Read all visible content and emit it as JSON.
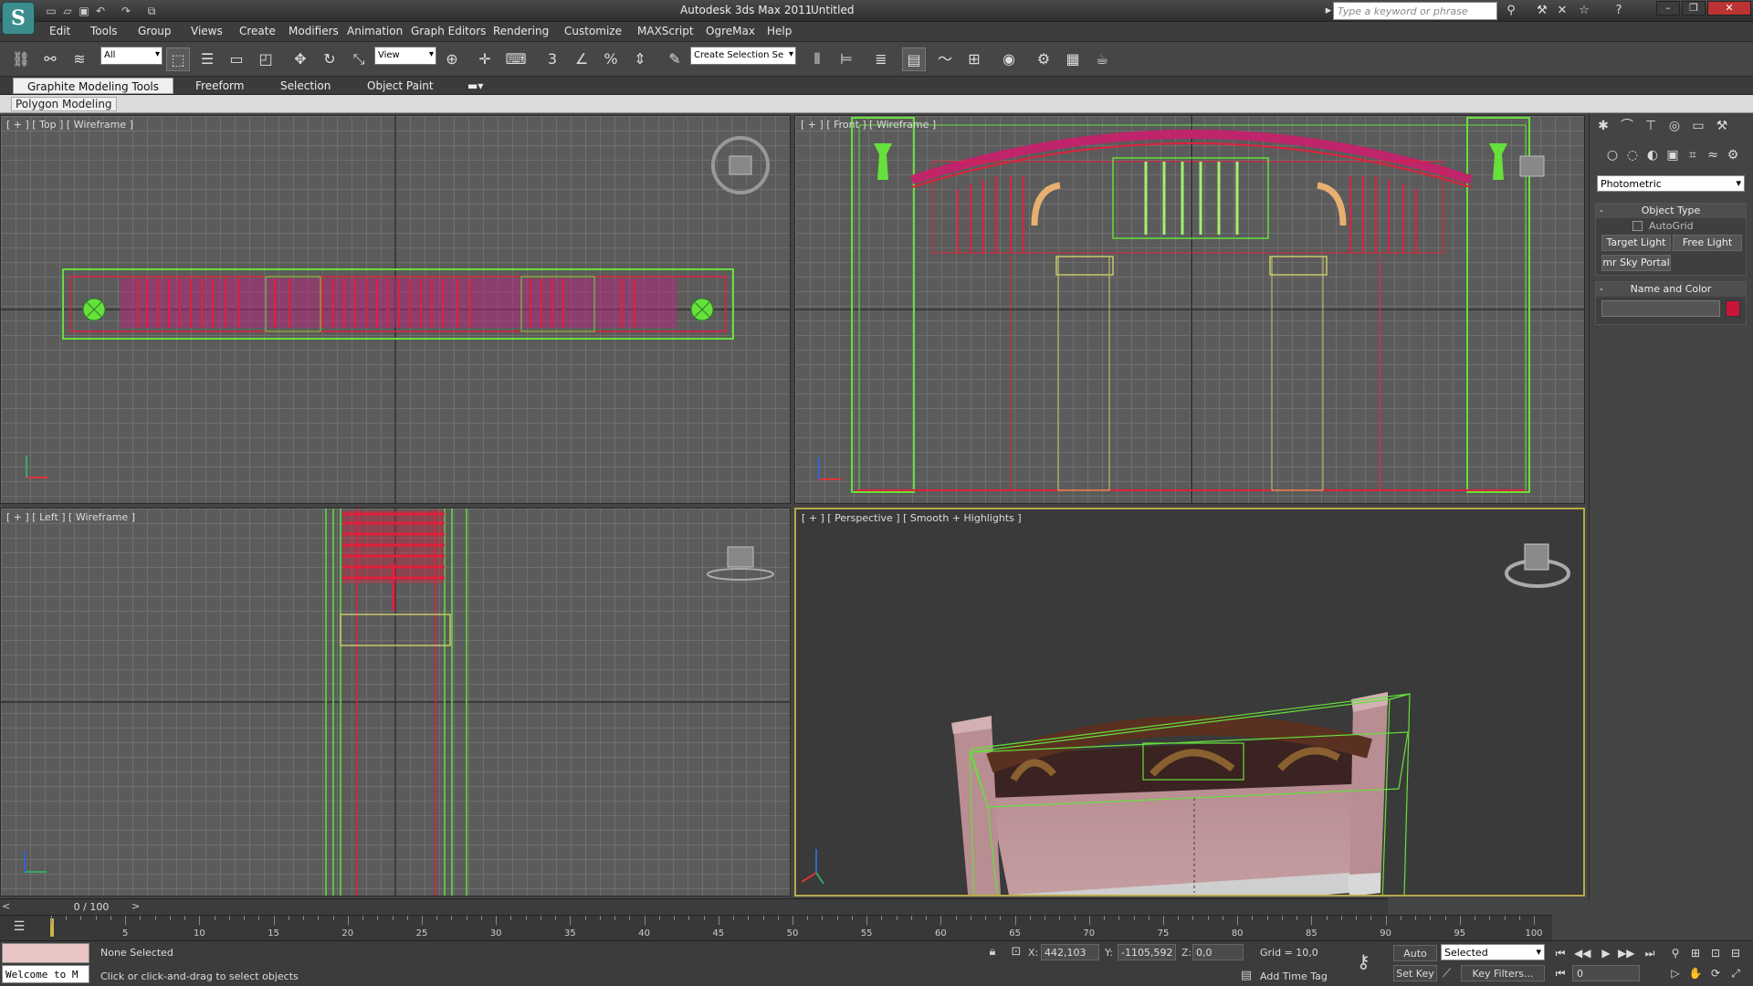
{
  "window": {
    "app_title": "Autodesk 3ds Max  2011",
    "document": "Untitled",
    "search_placeholder": "Type a keyword or phrase",
    "controls": [
      "–",
      "❐",
      "✕"
    ]
  },
  "menu": [
    "Edit",
    "Tools",
    "Group",
    "Views",
    "Create",
    "Modifiers",
    "Animation",
    "Graph Editors",
    "Rendering",
    "Customize",
    "MAXScript",
    "OgreMax",
    "Help"
  ],
  "toolbar": {
    "selection_filter": "All",
    "ref_coord": "View",
    "named_selection": "Create Selection Se"
  },
  "ribbon": {
    "tabs": [
      "Graphite Modeling Tools",
      "Freeform",
      "Selection",
      "Object Paint"
    ],
    "panel": "Polygon Modeling"
  },
  "viewports": {
    "top": "[ + ] [ Top ] [ Wireframe ]",
    "front": "[ + ] [ Front ] [ Wireframe ]",
    "left": "[ + ] [ Left ] [ Wireframe ]",
    "perspective": "[ + ] [ Perspective ] [ Smooth + Highlights ]"
  },
  "command_panel": {
    "category": "Photometric",
    "object_type": {
      "title": "Object Type",
      "autogrid": "AutoGrid",
      "buttons": [
        "Target Light",
        "Free Light",
        "mr Sky Portal"
      ]
    },
    "name_and_color": {
      "title": "Name and Color",
      "color": "#c8163a"
    }
  },
  "timeline": {
    "frame_label": "0 / 100",
    "ticks": [
      "5",
      "10",
      "15",
      "20",
      "25",
      "30",
      "35",
      "40",
      "45",
      "50",
      "55",
      "60",
      "65",
      "70",
      "75",
      "80",
      "85",
      "90",
      "95",
      "100"
    ]
  },
  "status": {
    "listener_text": "Welcome to M",
    "selection": "None Selected",
    "prompt": "Click or click-and-drag to select objects",
    "x_label": "X:",
    "x_value": "442,103",
    "y_label": "Y:",
    "y_value": "-1105,592",
    "z_label": "Z:",
    "z_value": "0,0",
    "grid": "Grid = 10,0",
    "add_time_tag": "Add Time Tag",
    "auto_key": "Auto Key",
    "set_key": "Set Key",
    "key_mode": "Selected",
    "key_filters": "Key Filters...",
    "current_frame": "0"
  },
  "colors": {
    "accent_viewport_border": "#b8a948",
    "wire_red": "#e0203c",
    "wire_green": "#66e03a",
    "wall": "#c89ba0"
  }
}
